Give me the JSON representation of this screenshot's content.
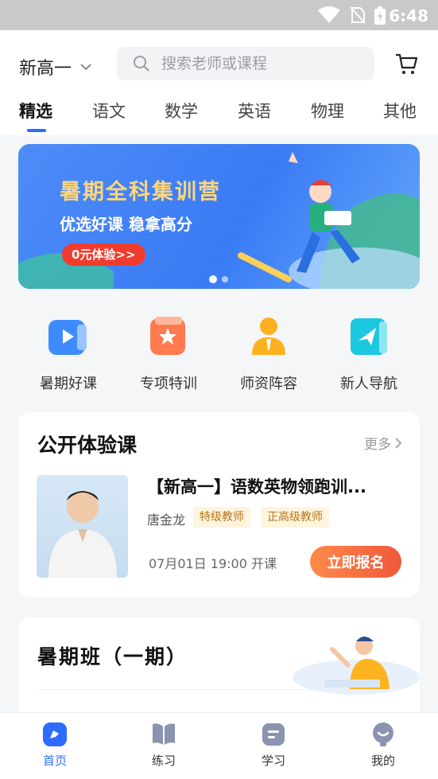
{
  "status": {
    "time": "6:48"
  },
  "header": {
    "grade": "新高一",
    "search_placeholder": "搜索老师或课程",
    "tabs": [
      "精选",
      "语文",
      "数学",
      "英语",
      "物理",
      "其他"
    ]
  },
  "banner": {
    "title": "暑期全科集训营",
    "subtitle": "优选好课 稳拿高分",
    "cta": "0元体验>>"
  },
  "quick_links": [
    "暑期好课",
    "专项特训",
    "师资阵容",
    "新人导航"
  ],
  "open_class": {
    "title": "公开体验课",
    "more": "更多",
    "course_title": "【新高一】语数英物领跑训...",
    "teacher": "唐金龙",
    "badges": [
      "特级教师",
      "正高级教师"
    ],
    "schedule": "07月01日 19:00 开课",
    "signup": "立即报名"
  },
  "summer_class": {
    "title": "暑期班（一期）"
  },
  "tabbar": [
    "首页",
    "练习",
    "学习",
    "我的"
  ],
  "colors": {
    "accent": "#2f6bff",
    "signup": "#f0583b",
    "badge_text": "#b8741a"
  }
}
